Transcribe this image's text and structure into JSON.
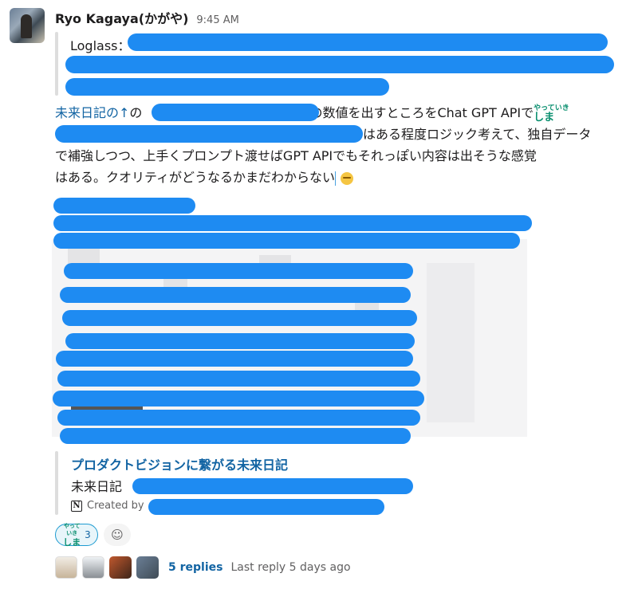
{
  "message": {
    "sender": "Ryo Kagaya(かがや)",
    "time": "9:45 AM",
    "quote_label": "Loglass：",
    "body": {
      "link_text": "未来日記の↑",
      "seg_no": "の",
      "line1_tail": "の数値を出すところをChat GPT APIで",
      "line2_tail": "はある程度ロジック考えて、独自データ",
      "line3": "で補強しつつ、上手くプロンプト渡せばGPT APIでもそれっぽい内容は出そうな感覚",
      "line4": "はある。クオリティがどうなるかまだわからない"
    },
    "inline_emoji_text": [
      "やっていき",
      "しま"
    ]
  },
  "link_card": {
    "title": "プロダクトビジョンに繋がる未来日記",
    "desc_prefix": "未来日記",
    "meta_prefix": "Created by",
    "icon_letter": "N"
  },
  "reactions": [
    {
      "emoji_text": [
        "やっていき",
        "しま"
      ],
      "count": "3"
    }
  ],
  "thread": {
    "replies": "5 replies",
    "last_reply": "Last reply 5 days ago"
  },
  "colors": {
    "link": "#1264a3",
    "redaction": "#1e8bf2",
    "reaction_border": "#1d9bd1"
  }
}
